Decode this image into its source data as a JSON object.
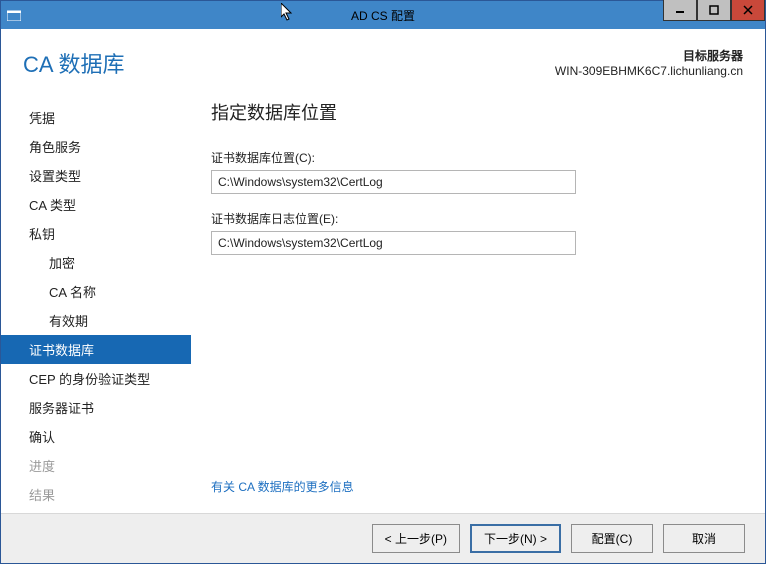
{
  "window": {
    "title": "AD CS 配置"
  },
  "header": {
    "page_title": "CA 数据库",
    "server_label": "目标服务器",
    "server_name": "WIN-309EBHMK6C7.lichunliang.cn"
  },
  "sidebar": {
    "items": [
      {
        "label": "凭据",
        "level": 1
      },
      {
        "label": "角色服务",
        "level": 1
      },
      {
        "label": "设置类型",
        "level": 1
      },
      {
        "label": "CA 类型",
        "level": 1
      },
      {
        "label": "私钥",
        "level": 1
      },
      {
        "label": "加密",
        "level": 2
      },
      {
        "label": "CA 名称",
        "level": 2
      },
      {
        "label": "有效期",
        "level": 2
      },
      {
        "label": "证书数据库",
        "level": 1,
        "active": true
      },
      {
        "label": "CEP 的身份验证类型",
        "level": 1
      },
      {
        "label": "服务器证书",
        "level": 1
      },
      {
        "label": "确认",
        "level": 1
      },
      {
        "label": "进度",
        "level": 1,
        "disabled": true
      },
      {
        "label": "结果",
        "level": 1,
        "disabled": true
      }
    ]
  },
  "main": {
    "heading": "指定数据库位置",
    "db_location_label": "证书数据库位置(C):",
    "db_location_value": "C:\\Windows\\system32\\CertLog",
    "db_log_location_label": "证书数据库日志位置(E):",
    "db_log_location_value": "C:\\Windows\\system32\\CertLog",
    "more_link": "有关 CA 数据库的更多信息"
  },
  "footer": {
    "prev": "< 上一步(P)",
    "next": "下一步(N) >",
    "configure": "配置(C)",
    "cancel": "取消"
  }
}
